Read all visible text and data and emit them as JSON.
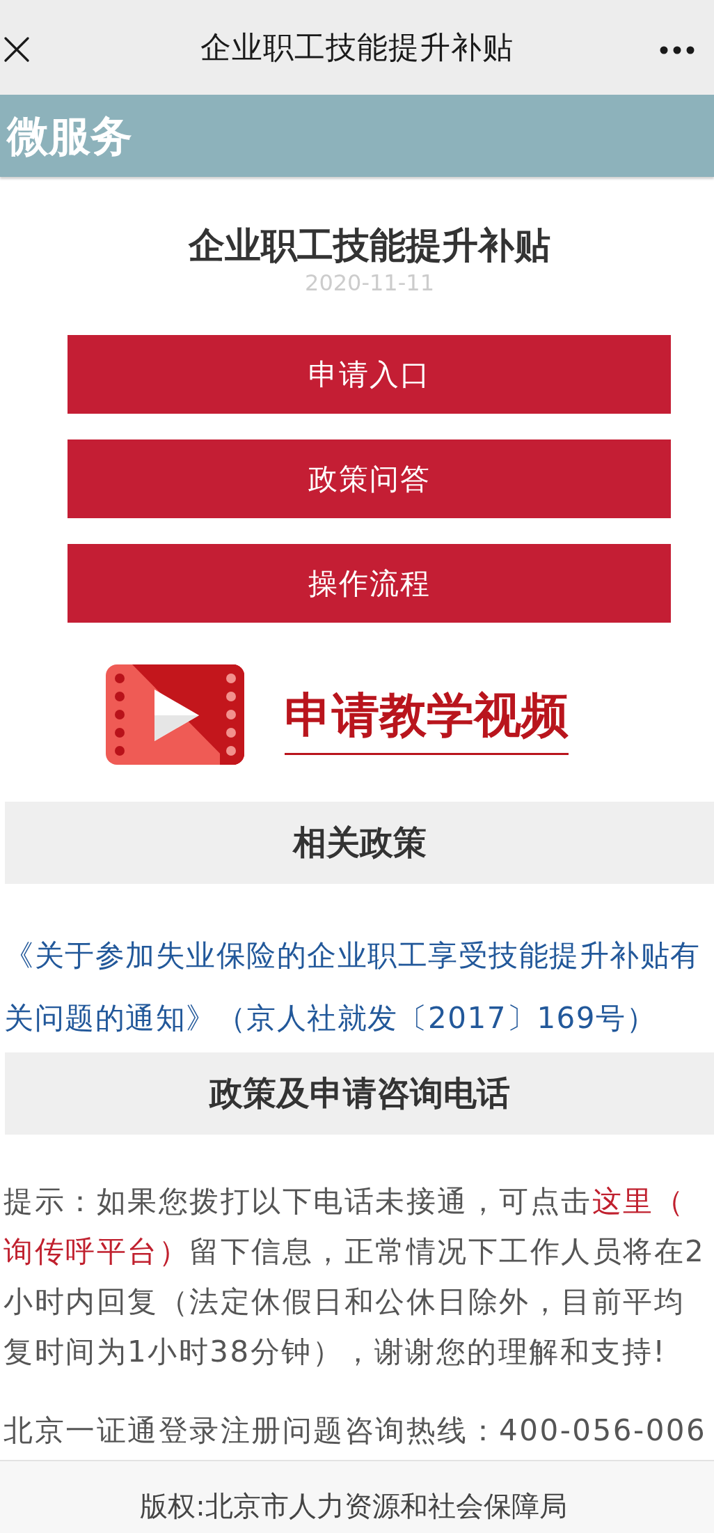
{
  "nav_bar": {
    "title": "企业职工技能提升补贴"
  },
  "header_banner": {
    "title": "微服务"
  },
  "article": {
    "title": "企业职工技能提升补贴",
    "date": "2020-11-11"
  },
  "buttons": [
    {
      "label": "申请入口"
    },
    {
      "label": "政策问答"
    },
    {
      "label": "操作流程"
    }
  ],
  "video_link": {
    "label": "申请教学视频"
  },
  "related_policies": {
    "heading": "相关政策",
    "document_link": {
      "lines": [
        "《关于参加失业保险的企业职工享受技能提升补贴有",
        "关问题的通知》（京人社就发〔2017〕169号）"
      ]
    }
  },
  "consultation": {
    "heading": "政策及申请咨询电话",
    "notice": {
      "lines": [
        [
          {
            "kind": "text",
            "text": "提示：如果您拨打以下电话未接通，可点击"
          },
          {
            "kind": "link",
            "text": "这里（"
          }
        ],
        [
          {
            "kind": "link",
            "text": "询传呼平台）"
          },
          {
            "kind": "text",
            "text": "留下信息，正常情况下工作人员将在2"
          }
        ],
        [
          {
            "kind": "text",
            "text": "小时内回复（法定休假日和公休日除外，目前平均"
          }
        ],
        [
          {
            "kind": "text",
            "text": "复时间为1小时38分钟），谢谢您的理解和支持!"
          }
        ]
      ]
    },
    "hotline": "北京一证通登录注册问题咨询热线：400-056-006"
  },
  "footer": {
    "copyright": "版权:北京市人力资源和社会保障局"
  }
}
